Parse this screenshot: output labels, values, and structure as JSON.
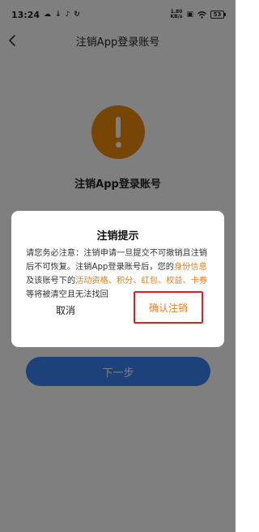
{
  "status_bar": {
    "time": "13:24",
    "net_speed_value": "1.80",
    "net_speed_unit": "KB/s",
    "battery": "53"
  },
  "nav": {
    "back_icon": "chevron-left-icon",
    "title": "注销App登录账号"
  },
  "page": {
    "warning_icon": "exclamation-icon",
    "heading": "注销App登录账号",
    "next_button": "下一步",
    "accent_color": "#ee8a0c",
    "primary_color": "#3b82f6"
  },
  "dialog": {
    "title": "注销提示",
    "body": {
      "part1": "请您务必注意：注销申请一旦提交不可撤销且注销后不可恢复。注销App登录账号后，您的",
      "highlight1": "身份信息",
      "part2": "及该账号下的",
      "highlight2": "活动资格、积分、红包、权益、卡券",
      "part3": "等将被清空且无法找回"
    },
    "cancel_label": "取消",
    "confirm_label": "确认注销",
    "highlight_color": "#ef7d1a"
  }
}
